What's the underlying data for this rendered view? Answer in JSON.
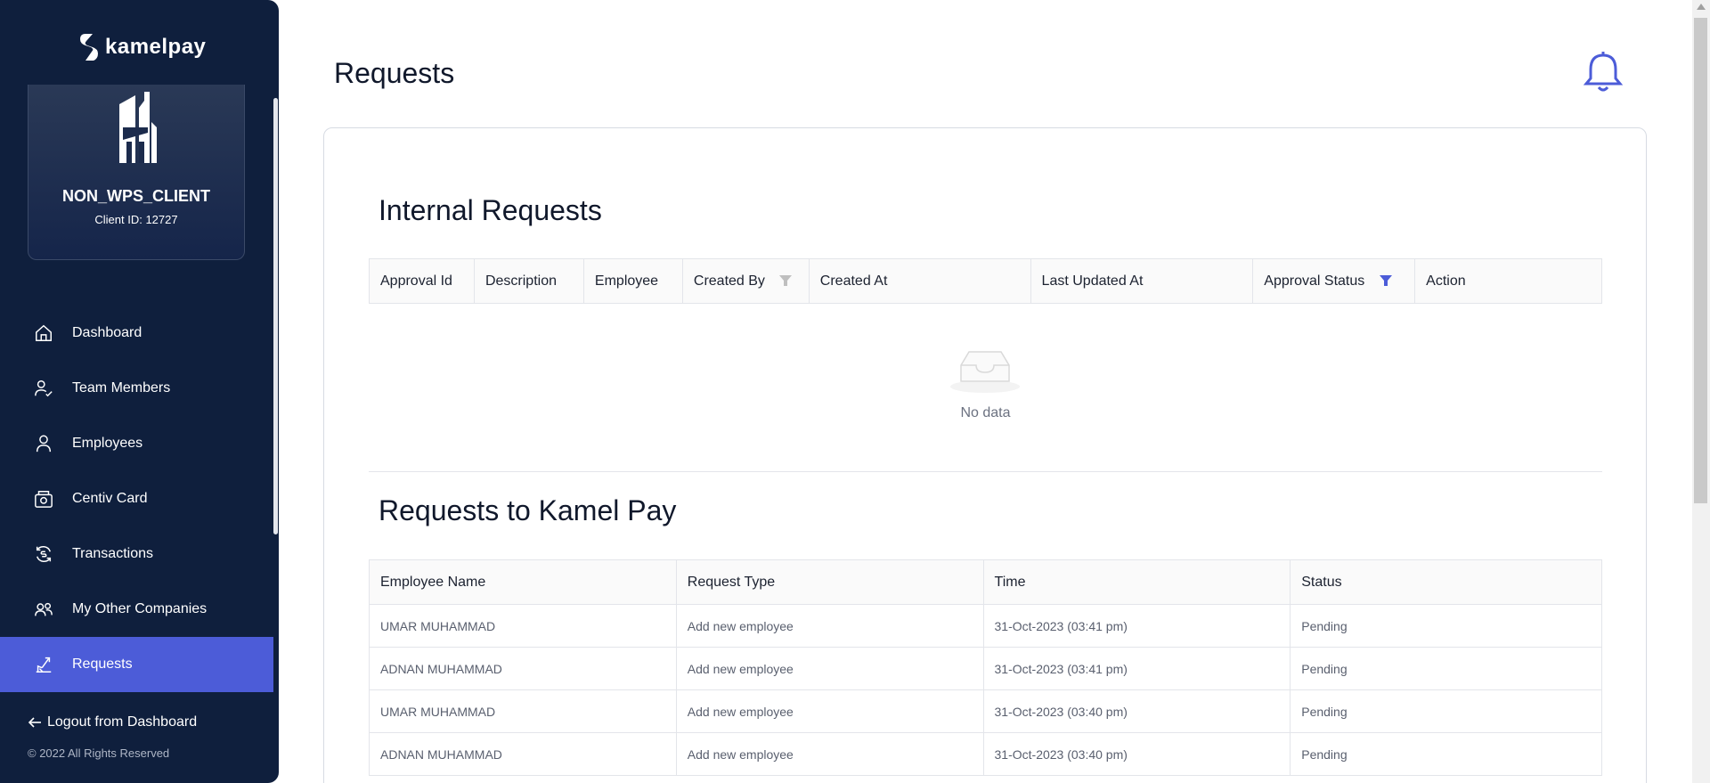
{
  "sidebar": {
    "logo_text": "kamelpay",
    "client_name": "NON_WPS_CLIENT",
    "client_id": "Client ID: 12727",
    "items": [
      {
        "label": "Dashboard",
        "icon": "home-icon"
      },
      {
        "label": "Team Members",
        "icon": "user-check-icon"
      },
      {
        "label": "Employees",
        "icon": "user-icon"
      },
      {
        "label": "Centiv Card",
        "icon": "card-icon"
      },
      {
        "label": "Transactions",
        "icon": "transactions-icon"
      },
      {
        "label": "My Other Companies",
        "icon": "users-icon"
      },
      {
        "label": "Requests",
        "icon": "requests-icon",
        "active": true
      }
    ],
    "logout_label": "Logout from Dashboard",
    "copyright": "© 2022 All Rights Reserved"
  },
  "header": {
    "title": "Requests"
  },
  "internal": {
    "title": "Internal Requests",
    "columns": [
      "Approval Id",
      "Description",
      "Employee",
      "Created By",
      "Created At",
      "Last Updated At",
      "Approval Status",
      "Action"
    ],
    "empty_text": "No data"
  },
  "kamel": {
    "title": "Requests to Kamel Pay",
    "columns": [
      "Employee Name",
      "Request Type",
      "Time",
      "Status"
    ],
    "rows": [
      [
        "UMAR MUHAMMAD",
        "Add new employee",
        "31-Oct-2023 (03:41 pm)",
        "Pending"
      ],
      [
        "ADNAN MUHAMMAD",
        "Add new employee",
        "31-Oct-2023 (03:41 pm)",
        "Pending"
      ],
      [
        "UMAR MUHAMMAD",
        "Add new employee",
        "31-Oct-2023 (03:40 pm)",
        "Pending"
      ],
      [
        "ADNAN MUHAMMAD",
        "Add new employee",
        "31-Oct-2023 (03:40 pm)",
        "Pending"
      ]
    ]
  },
  "colors": {
    "sidebar_bg": "#0f1f3d",
    "accent": "#4c5cd8"
  }
}
